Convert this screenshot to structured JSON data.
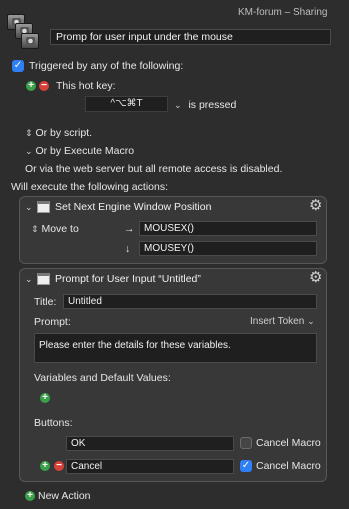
{
  "window": {
    "title": "KM-forum – Sharing"
  },
  "macro": {
    "name": "Promp for user input under the mouse"
  },
  "triggers": {
    "header": "Triggered by any of the following:",
    "hotkey_label": "This hot key:",
    "hotkey_value": "^⌥⌘T",
    "hotkey_state": "is pressed",
    "or_script": "Or by script.",
    "or_execute_macro": "Or by Execute Macro",
    "web_server_note": "Or via the web server but all remote access is disabled."
  },
  "actions_header": "Will execute the following actions:",
  "action1": {
    "title": "Set Next Engine Window Position",
    "move_to_label": "Move to",
    "x_value": "MOUSEX()",
    "y_value": "MOUSEY()"
  },
  "action2": {
    "title": "Prompt for User Input “Untitled”",
    "title_label": "Title:",
    "title_value": "Untitled",
    "prompt_label": "Prompt:",
    "insert_token": "Insert Token",
    "prompt_value": "Please enter the details for these variables.",
    "variables_label": "Variables and Default Values:",
    "buttons_label": "Buttons:",
    "buttons": [
      {
        "name": "OK",
        "cancel_label": "Cancel Macro",
        "cancel_checked": false
      },
      {
        "name": "Cancel",
        "cancel_label": "Cancel Macro",
        "cancel_checked": true
      }
    ]
  },
  "footer": {
    "new_action": "New Action"
  },
  "icons": {
    "check": "✓",
    "plus": "+",
    "minus": "−",
    "gear": "⚙",
    "arrow_right": "→",
    "arrow_down": "↓",
    "updown": "⌃⌄",
    "chevron_down": "⌄"
  },
  "colors": {
    "accent": "#2f7ff5",
    "add": "#3aa14a",
    "remove": "#d6413b",
    "background": "#2d2d2e"
  }
}
